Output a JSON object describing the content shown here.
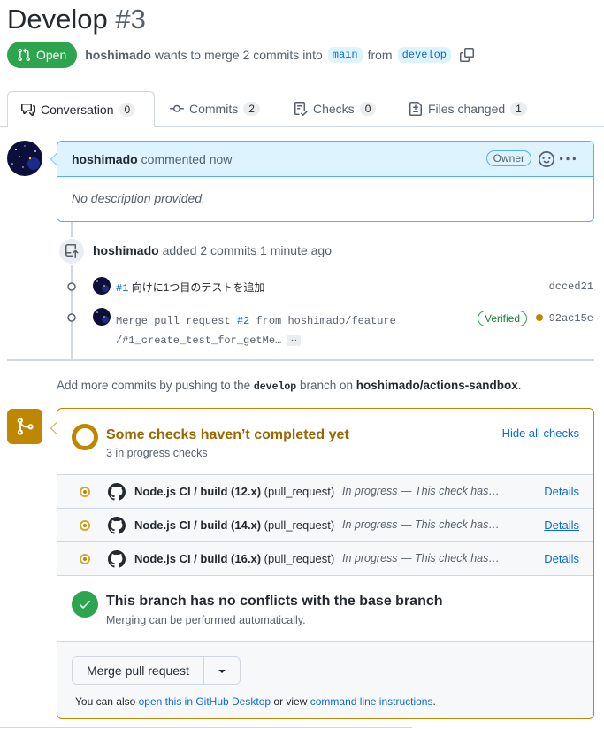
{
  "pr": {
    "title": "Develop",
    "number": "#3",
    "state": "Open",
    "author": "hoshimado",
    "meta_text": "wants to merge 2 commits into",
    "base_branch": "main",
    "from_text": "from",
    "head_branch": "develop"
  },
  "tabs": [
    {
      "label": "Conversation",
      "count": "0",
      "icon": "comment-discussion-icon"
    },
    {
      "label": "Commits",
      "count": "2",
      "icon": "git-commit-icon"
    },
    {
      "label": "Checks",
      "count": "0",
      "icon": "checklist-icon"
    },
    {
      "label": "Files changed",
      "count": "1",
      "icon": "file-diff-icon"
    }
  ],
  "comment": {
    "author": "hoshimado",
    "when": "commented now",
    "badge": "Owner",
    "body": "No description provided."
  },
  "push_event": {
    "author": "hoshimado",
    "text": "added 2 commits 1 minute ago"
  },
  "commits": [
    {
      "ref": "#1",
      "message": "向けに1つ目のテストを追加",
      "sha": "dcced21"
    },
    {
      "prefix": "Merge pull request",
      "ref": "#2",
      "suffix": "from hoshimado/feature",
      "line2": "/#1_create_test_for_getMe…",
      "ellipsis": "…",
      "verified": "Verified",
      "sha": "92ac15e"
    }
  ],
  "push_hint": {
    "before": "Add more commits by pushing to the",
    "branch": "develop",
    "middle": "branch on",
    "repo": "hoshimado/actions-sandbox",
    "after": "."
  },
  "checks": {
    "title": "Some checks haven’t completed yet",
    "subtitle": "3 in progress checks",
    "hide_label": "Hide all checks",
    "rows": [
      {
        "name": "Node.js CI / build (12.x)",
        "event": "(pull_request)",
        "status": "In progress — This check has started...",
        "details": "Details"
      },
      {
        "name": "Node.js CI / build (14.x)",
        "event": "(pull_request)",
        "status": "In progress — This check has started...",
        "details": "Details"
      },
      {
        "name": "Node.js CI / build (16.x)",
        "event": "(pull_request)",
        "status": "In progress — This check has started...",
        "details": "Details"
      }
    ]
  },
  "conflicts": {
    "title": "This branch has no conflicts with the base branch",
    "subtitle": "Merging can be performed automatically."
  },
  "merge": {
    "button": "Merge pull request",
    "note_before": "You can also",
    "desktop_link": "open this in GitHub Desktop",
    "note_middle": "or view",
    "cli_link": "command line instructions",
    "note_after": "."
  },
  "colors": {
    "open_green": "#2da44e",
    "pending_yellow": "#bf8700",
    "link_blue": "#0969da",
    "comment_header": "#ddf4ff"
  }
}
